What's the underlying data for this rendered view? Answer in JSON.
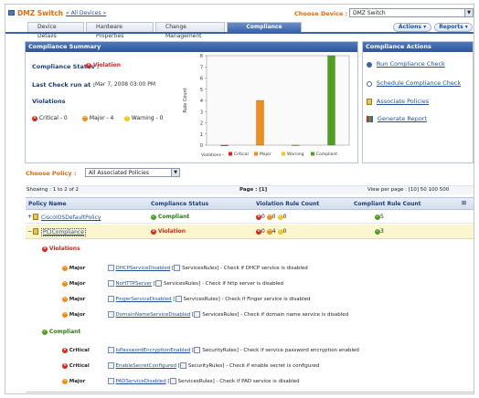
{
  "header": {
    "title": "DMZ Switch",
    "all_devices": "« All Devices »",
    "choose_device_label": "Choose Device :",
    "choose_device_value": "DMZ Switch",
    "actions_button": "Actions ▾",
    "reports_button": "Reports ▾"
  },
  "tabs": [
    "Device Details",
    "Hardware Properties",
    "Change Management",
    "Compliance"
  ],
  "summary": {
    "heading": "Compliance Summary",
    "status_label": "Compliance Status :",
    "status_value": "Violation",
    "last_check_label": "Last Check run at :",
    "last_check_value": "Mar 7, 2008 03:00 PM",
    "violations_label": "Violations",
    "critical": "Critical - 0",
    "major": "Major - 4",
    "warning": "Warning - 0"
  },
  "chart_data": {
    "type": "bar",
    "categories": [
      "Critical",
      "Major",
      "Warning",
      "Compliant"
    ],
    "values": [
      0,
      4,
      0,
      8
    ],
    "ylabel": "Rule Count",
    "ylim": [
      0,
      8
    ],
    "yticks": [
      "0",
      "1",
      "2",
      "3",
      "4",
      "5",
      "6",
      "7",
      "8"
    ],
    "legend_title": "Violations -",
    "colors": [
      "#d9251c",
      "#f28d16",
      "#f5c518",
      "#4ea01f"
    ]
  },
  "actions": {
    "heading": "Compliance Actions",
    "items": [
      "Run Compliance Check",
      "Schedule Compliance Check",
      "Associate Policies",
      "Generate Report"
    ]
  },
  "policy_filter": {
    "label": "Choose Policy :",
    "value": "All Associated Policies"
  },
  "pager": {
    "showing": "Showing : 1 to 2 of 2",
    "page": "Page : [1]",
    "view_per_page": "View per page : [10] 50 100 500"
  },
  "grid": {
    "columns": [
      "Policy Name",
      "Compliance Status",
      "Violation Rule Count",
      "Compliant Rule Count"
    ],
    "rows": [
      {
        "name": "CiscoIOSDefaultPolicy",
        "status": "Compliant",
        "critical": "0",
        "major": "0",
        "warning": "0",
        "compliant": "5"
      },
      {
        "name": "PCICompliance",
        "status": "Violation",
        "critical": "0",
        "major": "4",
        "warning": "0",
        "compliant": "3"
      }
    ]
  },
  "details": {
    "violations_label": "Violations",
    "compliant_label": "Compliant",
    "violations": [
      {
        "severity": "Major",
        "rule": "DHCPServiceDisabled",
        "group": "ServicesRules",
        "desc": "- Check if DHCP service is disabled"
      },
      {
        "severity": "Major",
        "rule": "NoHTTPServer",
        "group": "ServicesRules",
        "desc": "- Check if http server is disabled"
      },
      {
        "severity": "Major",
        "rule": "FingerServiceDisabled",
        "group": "ServicesRules",
        "desc": "- Check if Finger service is disabled"
      },
      {
        "severity": "Major",
        "rule": "DomainNameServiceDisabled",
        "group": "ServicesRules",
        "desc": "- Check if domain name service is disabled"
      }
    ],
    "compliant": [
      {
        "severity": "Critical",
        "rule": "IsPasswordEncryptionEnabled",
        "group": "SecurityRules",
        "desc": "- Check if service password encryption enabled"
      },
      {
        "severity": "Critical",
        "rule": "EnableSecretConfigured",
        "group": "SecurityRules",
        "desc": "- Check if enable secret is configured"
      },
      {
        "severity": "Major",
        "rule": "PADServiceDisabled",
        "group": "ServicesRules",
        "desc": "- Check if PAD service is disabled"
      }
    ]
  }
}
